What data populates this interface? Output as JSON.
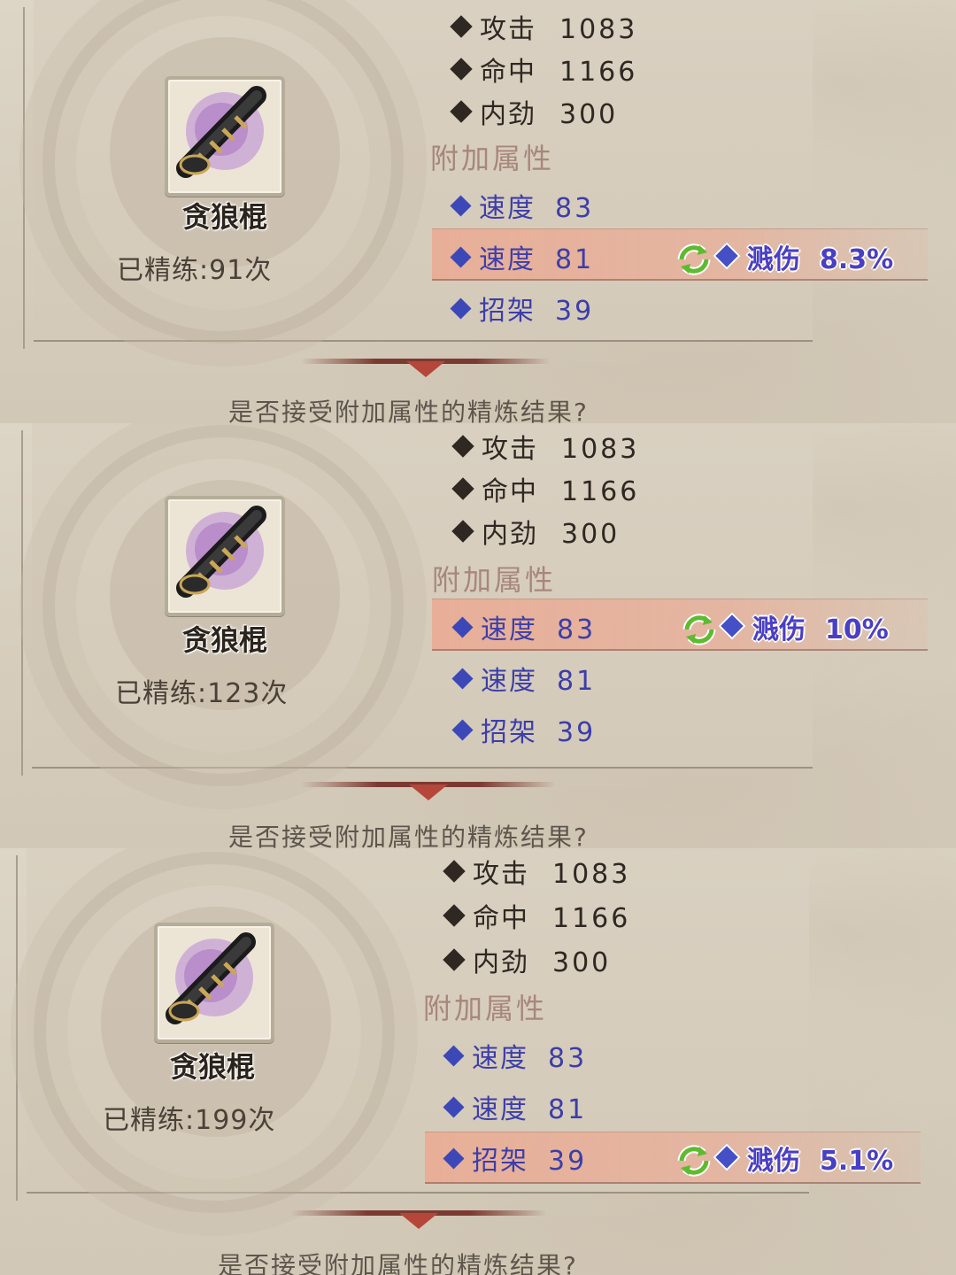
{
  "panels": [
    {
      "item_name": "贪狼棍",
      "refine_text": "已精练:91次",
      "base_stats": [
        {
          "name": "攻击",
          "value": "1083"
        },
        {
          "name": "命中",
          "value": "1166"
        },
        {
          "name": "内劲",
          "value": "300"
        }
      ],
      "extra_label": "附加属性",
      "extra_stats": [
        {
          "name": "速度",
          "value": "83"
        },
        {
          "name": "速度",
          "value": "81"
        },
        {
          "name": "招架",
          "value": "39"
        }
      ],
      "highlight_index": 1,
      "new_attr": {
        "name": "溅伤",
        "value": "8.3%"
      },
      "prompt": "是否接受附加属性的精炼结果?"
    },
    {
      "item_name": "贪狼棍",
      "refine_text": "已精练:123次",
      "base_stats": [
        {
          "name": "攻击",
          "value": "1083"
        },
        {
          "name": "命中",
          "value": "1166"
        },
        {
          "name": "内劲",
          "value": "300"
        }
      ],
      "extra_label": "附加属性",
      "extra_stats": [
        {
          "name": "速度",
          "value": "83"
        },
        {
          "name": "速度",
          "value": "81"
        },
        {
          "name": "招架",
          "value": "39"
        }
      ],
      "highlight_index": 0,
      "new_attr": {
        "name": "溅伤",
        "value": "10%"
      },
      "prompt": "是否接受附加属性的精炼结果?"
    },
    {
      "item_name": "贪狼棍",
      "refine_text": "已精练:199次",
      "base_stats": [
        {
          "name": "攻击",
          "value": "1083"
        },
        {
          "name": "命中",
          "value": "1166"
        },
        {
          "name": "内劲",
          "value": "300"
        }
      ],
      "extra_label": "附加属性",
      "extra_stats": [
        {
          "name": "速度",
          "value": "83"
        },
        {
          "name": "速度",
          "value": "81"
        },
        {
          "name": "招架",
          "value": "39"
        }
      ],
      "highlight_index": 2,
      "new_attr": {
        "name": "溅伤",
        "value": "5.1%"
      },
      "prompt": "是否接受附加属性的精炼结果?"
    }
  ],
  "icons": {
    "weapon": "wolf-staff-icon",
    "swap": "swap-arrows-icon"
  },
  "colors": {
    "base_stat": "#2f2822",
    "extra_stat": "#3c3ea9",
    "section_label": "#a7877a",
    "highlight": "#e9ad96",
    "new_attr_text": "#4a3fc4",
    "swap_icon": "#5dbb2f",
    "divider": "#7b3a31"
  }
}
